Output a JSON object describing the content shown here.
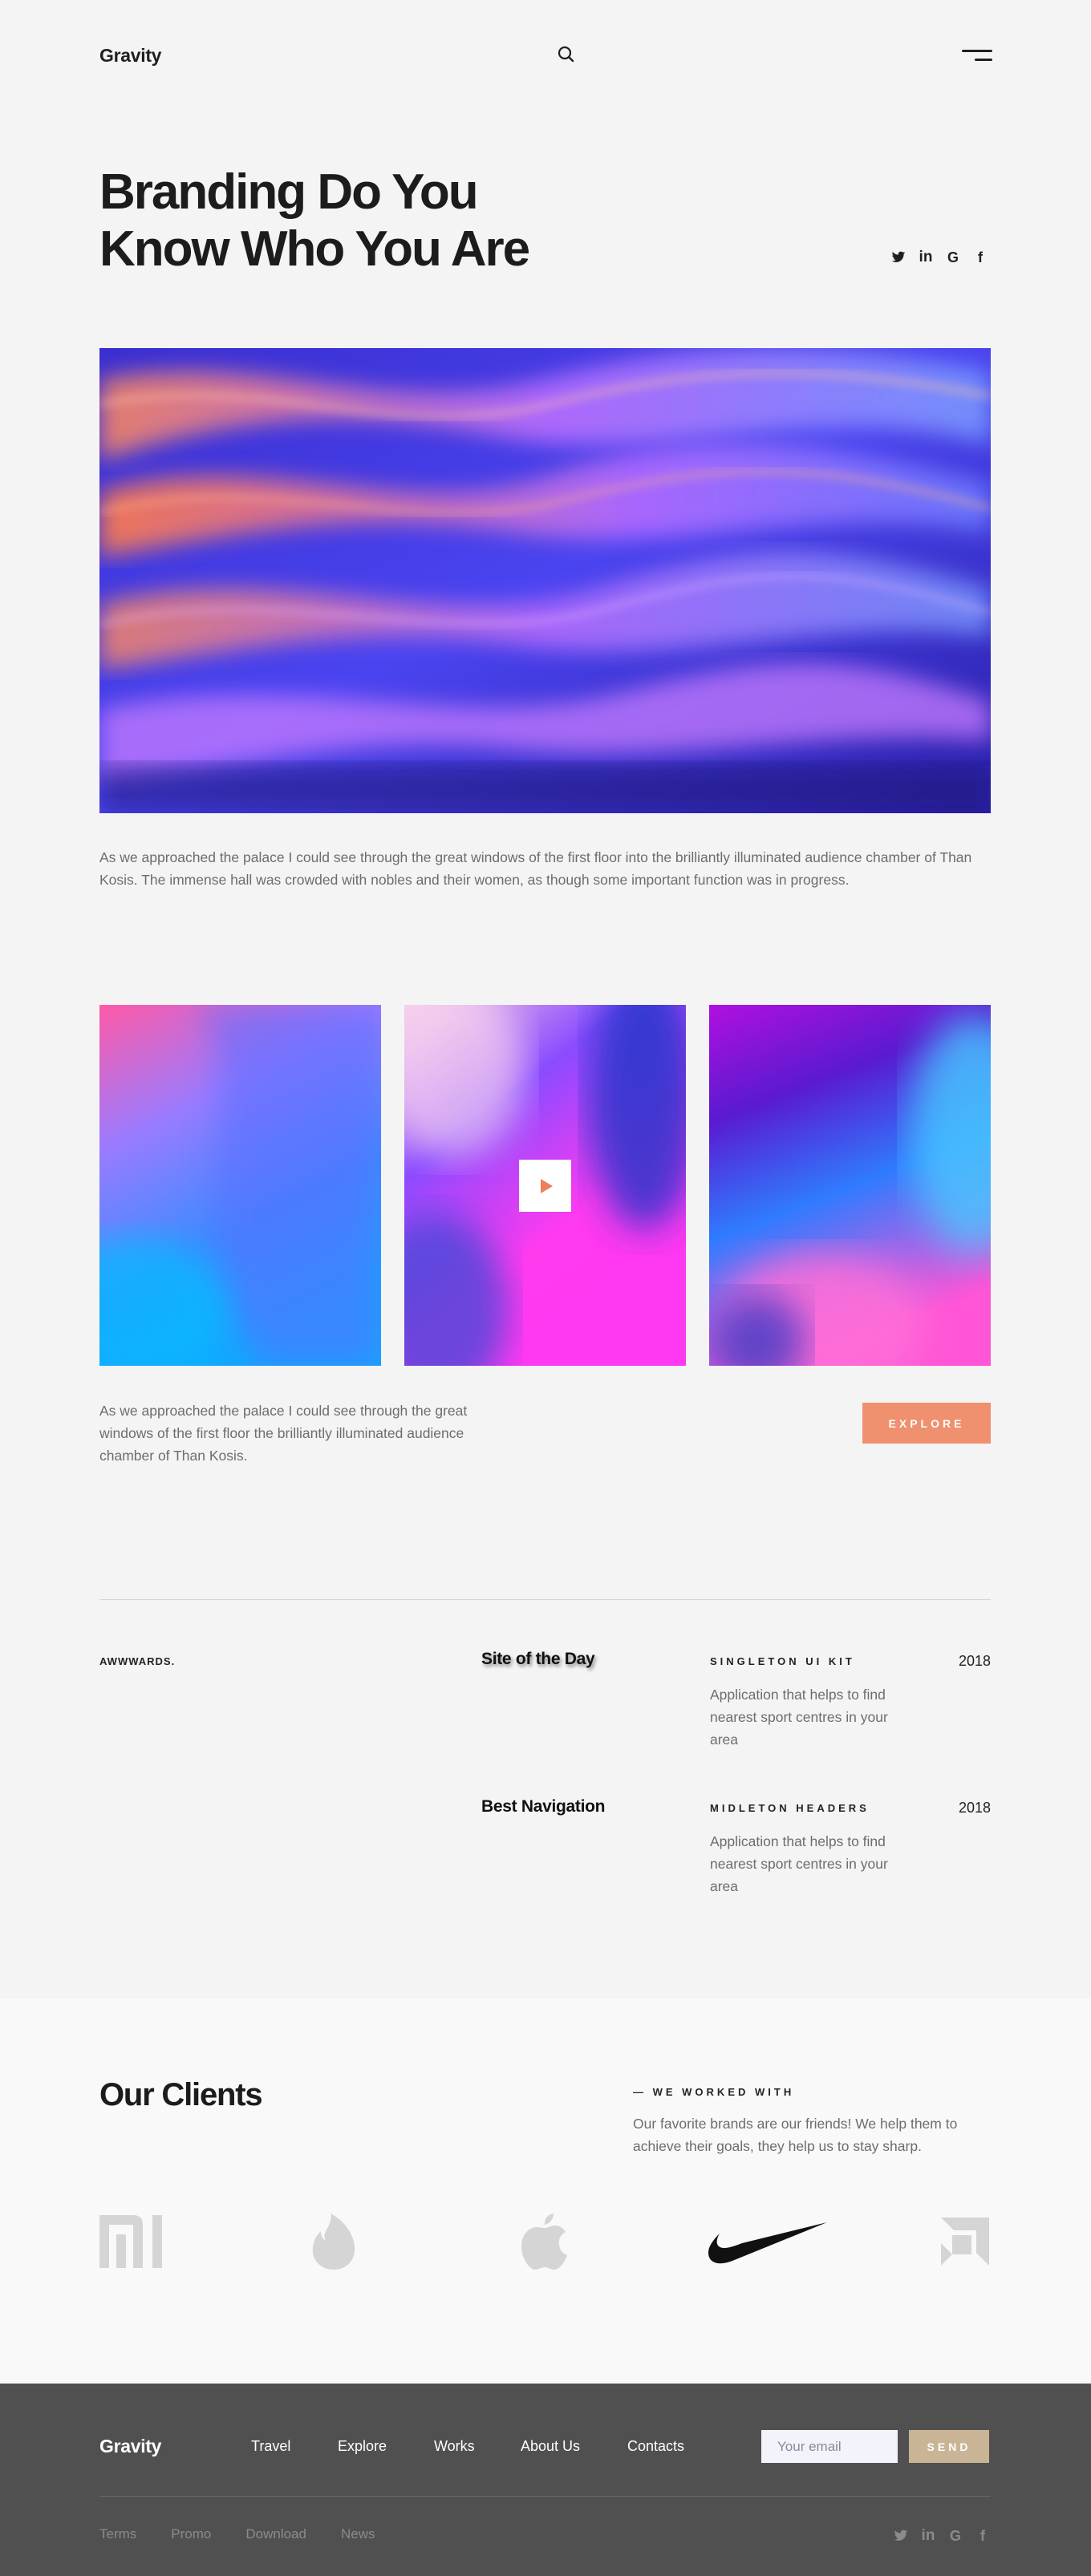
{
  "header": {
    "logo": "Gravity",
    "search_icon": "search-icon",
    "menu_icon": "hamburger-menu-icon"
  },
  "hero": {
    "title_line1": "Branding Do You",
    "title_line2": "Know Who You Are",
    "social": [
      {
        "icon": "twitter-icon",
        "glyph": "𝕏"
      },
      {
        "icon": "linkedin-icon",
        "glyph": "in"
      },
      {
        "icon": "google-icon",
        "glyph": "G"
      },
      {
        "icon": "facebook-icon",
        "glyph": "f"
      }
    ],
    "text": "As we approached the palace I could see through the great windows of the first floor into the brilliantly illuminated audience chamber of Than Kosis. The immense hall was crowded with nobles and their women, as though some important function was in progress."
  },
  "gallery": {
    "text": "As we approached the palace I could see through the great windows of the first floor the brilliantly illuminated audience chamber of Than Kosis.",
    "explore_label": "EXPLORE",
    "play_icon": "play-icon"
  },
  "awards": {
    "label": "AWWWARDS.",
    "items": [
      {
        "name": "Site of the Day",
        "kit": "SINGLETON UI KIT",
        "desc": "Application that helps to find nearest sport centres in your area",
        "year": "2018"
      },
      {
        "name": "Best Navigation",
        "kit": "MIDLETON HEADERS",
        "desc": "Application that helps to find nearest sport centres in your area",
        "year": "2018"
      }
    ]
  },
  "clients": {
    "title": "Our Clients",
    "eyebrow": "— WE WORKED WITH",
    "text": "Our favorite brands are our friends! We help them to achieve their goals, they help us to stay sharp.",
    "logos": [
      "xiaomi-logo",
      "tinder-logo",
      "apple-logo",
      "nike-logo",
      "amd-logo"
    ]
  },
  "footer": {
    "logo": "Gravity",
    "nav": [
      "Travel",
      "Explore",
      "Works",
      "About Us",
      "Contacts"
    ],
    "email_placeholder": "Your email",
    "send_label": "SEND",
    "links": [
      "Terms",
      "Promo",
      "Download",
      "News"
    ]
  },
  "colors": {
    "accent": "#ef916f",
    "send": "#c9b595",
    "footer_bg": "#505050",
    "page_bg": "#f4f4f4"
  }
}
